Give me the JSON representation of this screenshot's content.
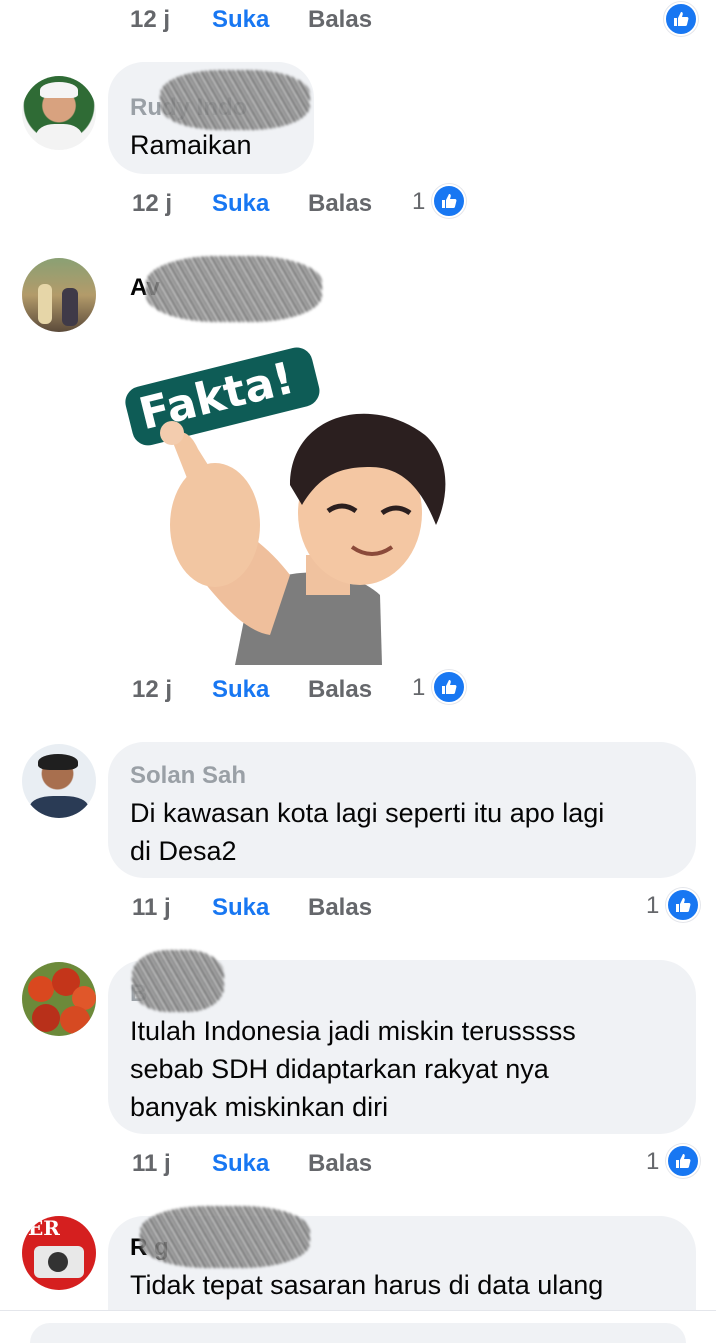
{
  "colors": {
    "link": "#1877f2",
    "meta": "#65676b",
    "bubble": "#f0f2f5",
    "sticker_badge": "#0e5c56"
  },
  "top_partial": {
    "time": "12 j",
    "like": "Suka",
    "reply": "Balas"
  },
  "comments": [
    {
      "name": "Rudy Indo",
      "text": "Ramaikan",
      "time": "12 j",
      "like": "Suka",
      "reply": "Balas",
      "reactions": "1",
      "avatar": "man-white-cap-avatar"
    },
    {
      "name": "Av",
      "sticker_text": "Fakta!",
      "time": "12 j",
      "like": "Suka",
      "reply": "Balas",
      "reactions": "1",
      "avatar": "group-photo-avatar"
    },
    {
      "name": "Solan Sah",
      "text_lines": [
        "Di kawasan kota lagi seperti itu apo lagi",
        "di Desa2"
      ],
      "time": "11 j",
      "like": "Suka",
      "reply": "Balas",
      "reactions": "1",
      "avatar": "man-pointing-avatar"
    },
    {
      "name": "B",
      "text_lines": [
        "Itulah Indonesia jadi miskin terusssss",
        "sebab SDH didaptarkan rakyat nya",
        "banyak miskinkan diri"
      ],
      "time": "11 j",
      "like": "Suka",
      "reply": "Balas",
      "reactions": "1",
      "avatar": "tomatoes-avatar"
    },
    {
      "name": "R g",
      "text": "Tidak tepat sasaran harus di data ulang",
      "avatar": "camera-red-avatar",
      "avatar_text": "ER"
    }
  ]
}
